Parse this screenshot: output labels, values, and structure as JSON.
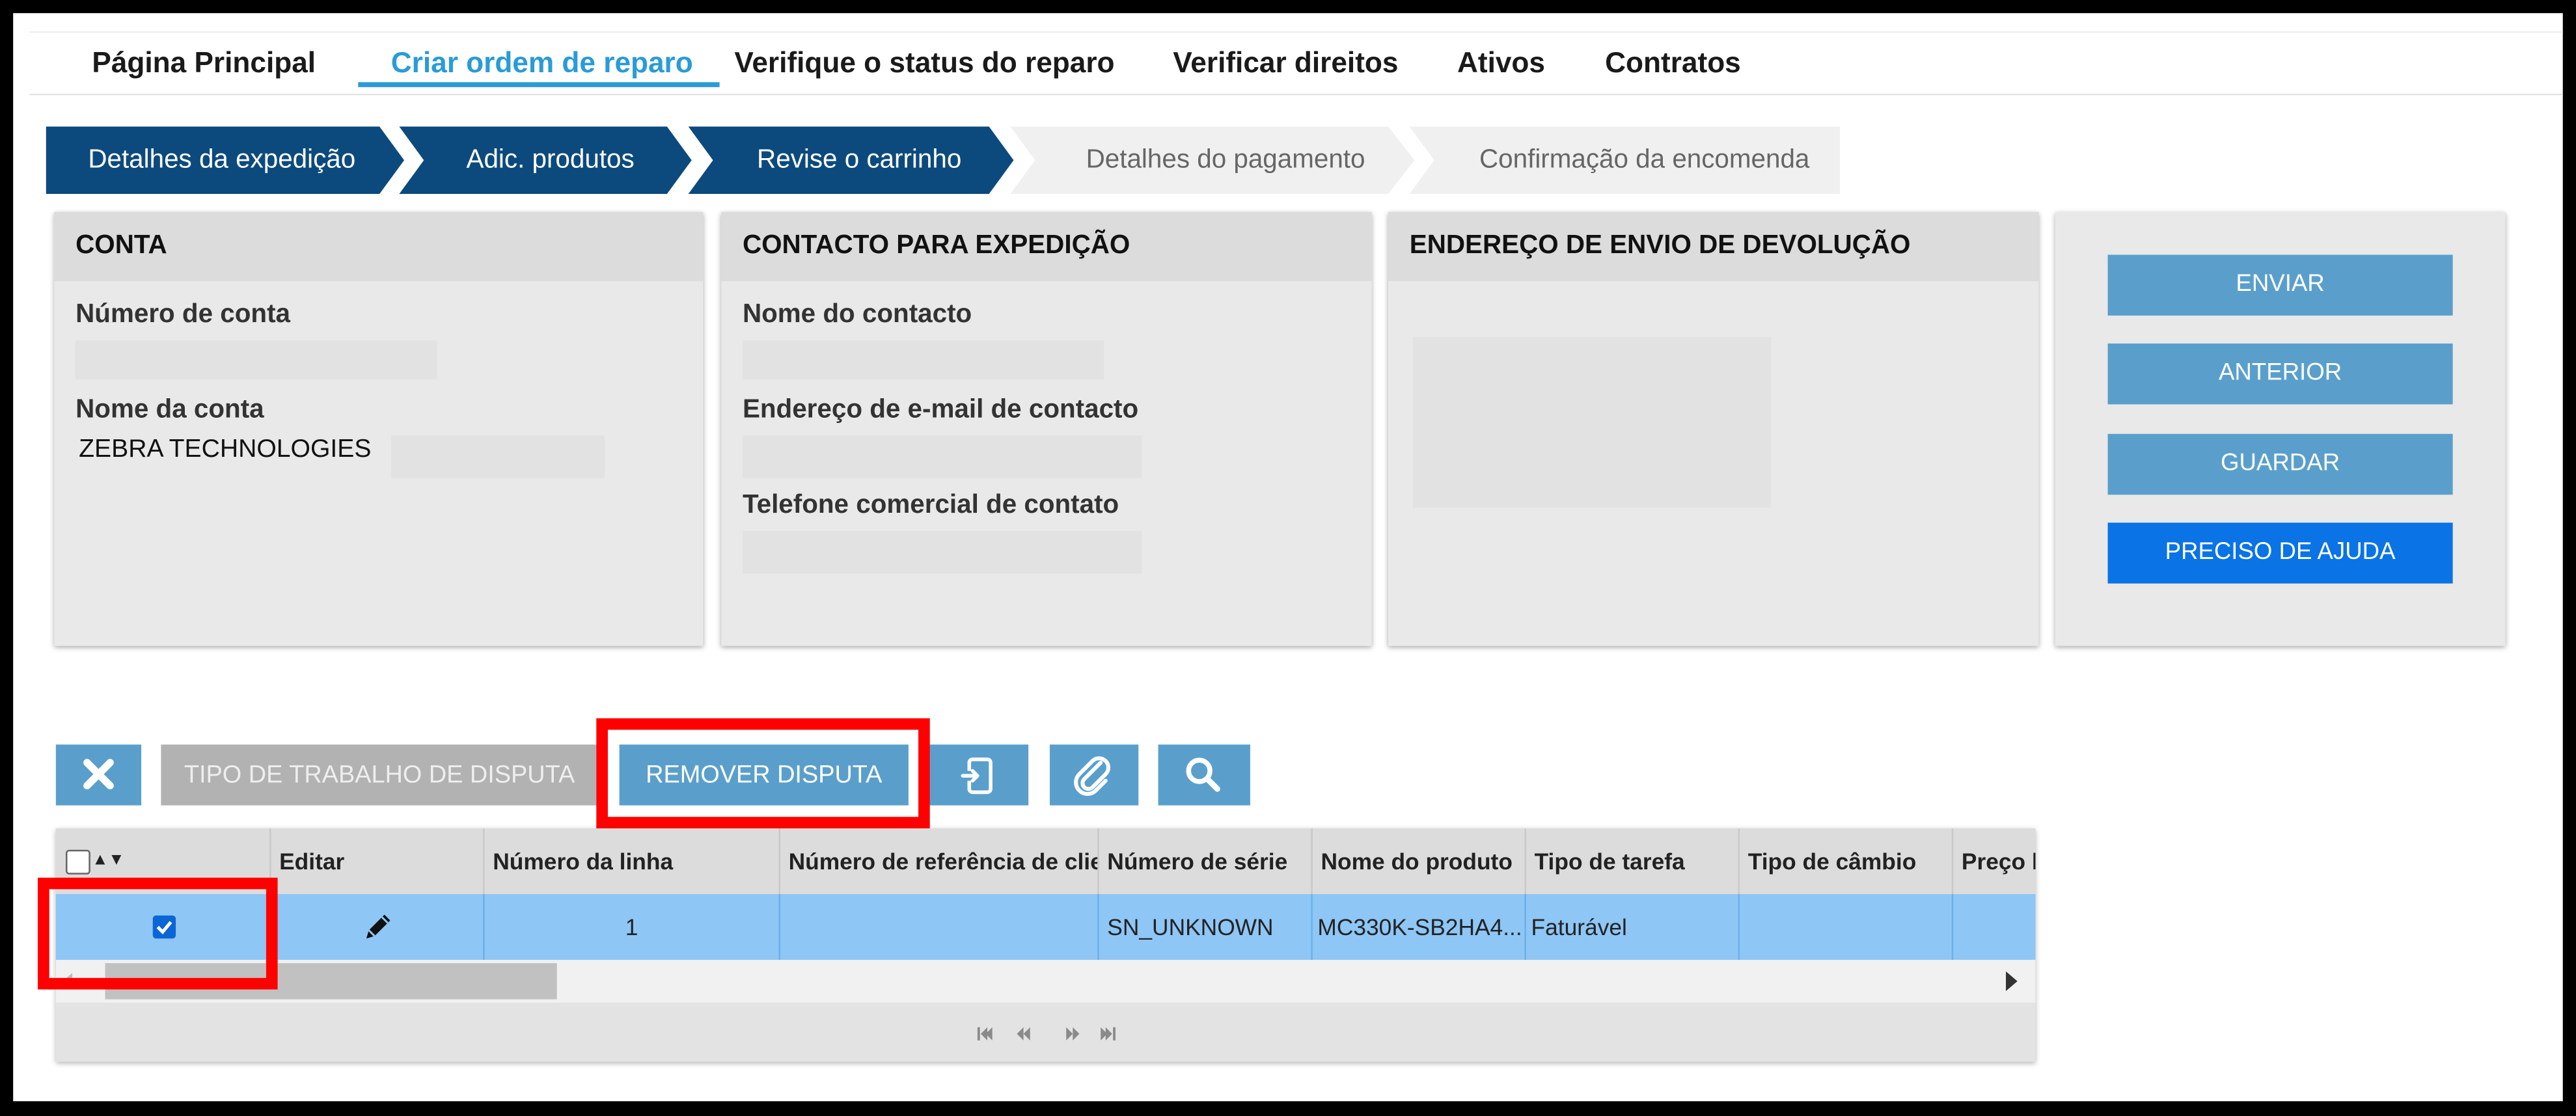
{
  "nav": {
    "items": [
      {
        "label": "Página Principal"
      },
      {
        "label": "Criar ordem de reparo"
      },
      {
        "label": "Verifique o status do reparo"
      },
      {
        "label": "Verificar direitos"
      },
      {
        "label": "Ativos"
      },
      {
        "label": "Contratos"
      }
    ],
    "active_index": 1
  },
  "steps": [
    {
      "label": "Detalhes da expedição",
      "state": "done"
    },
    {
      "label": "Adic. produtos",
      "state": "done"
    },
    {
      "label": "Revise o carrinho",
      "state": "current"
    },
    {
      "label": "Detalhes do pagamento",
      "state": "pending"
    },
    {
      "label": "Confirmação da encomenda",
      "state": "pending"
    }
  ],
  "panels": {
    "account": {
      "title": "CONTA",
      "account_number_label": "Número de conta",
      "account_name_label": "Nome da conta",
      "account_name_value": "ZEBRA TECHNOLOGIES"
    },
    "shipping_contact": {
      "title": "CONTACTO PARA EXPEDIÇÃO",
      "contact_name_label": "Nome do contacto",
      "email_label": "Endereço de e-mail de contacto",
      "phone_label": "Telefone comercial de contato"
    },
    "return_address": {
      "title": "ENDEREÇO DE ENVIO DE DEVOLUÇÃO"
    },
    "actions": {
      "submit": "ENVIAR",
      "previous": "ANTERIOR",
      "save": "GUARDAR",
      "help": "PRECISO DE AJUDA"
    }
  },
  "toolbar": {
    "dispute_work_type": "TIPO DE TRABALHO DE DISPUTA",
    "remove_dispute": "REMOVER DISPUTA"
  },
  "grid": {
    "columns": [
      "Editar",
      "Número da linha",
      "Número de referência de clien",
      "Número de série",
      "Nome do produto",
      "Tipo de tarefa",
      "Tipo de câmbio",
      "Preço l"
    ],
    "rows": [
      {
        "selected": true,
        "line_number": "1",
        "customer_reference": "",
        "serial_number": "SN_UNKNOWN",
        "product_name": "MC330K-SB2HA4...",
        "task_type": "Faturável",
        "exchange_type": "",
        "price": ""
      }
    ]
  },
  "colors": {
    "nav_active": "#2a9bd8",
    "step_done": "#0c4a7d",
    "action_button": "#5a9fcb",
    "help_button": "#0a73e6",
    "selected_row": "#8ec6f6",
    "highlight": "#ff0000"
  }
}
